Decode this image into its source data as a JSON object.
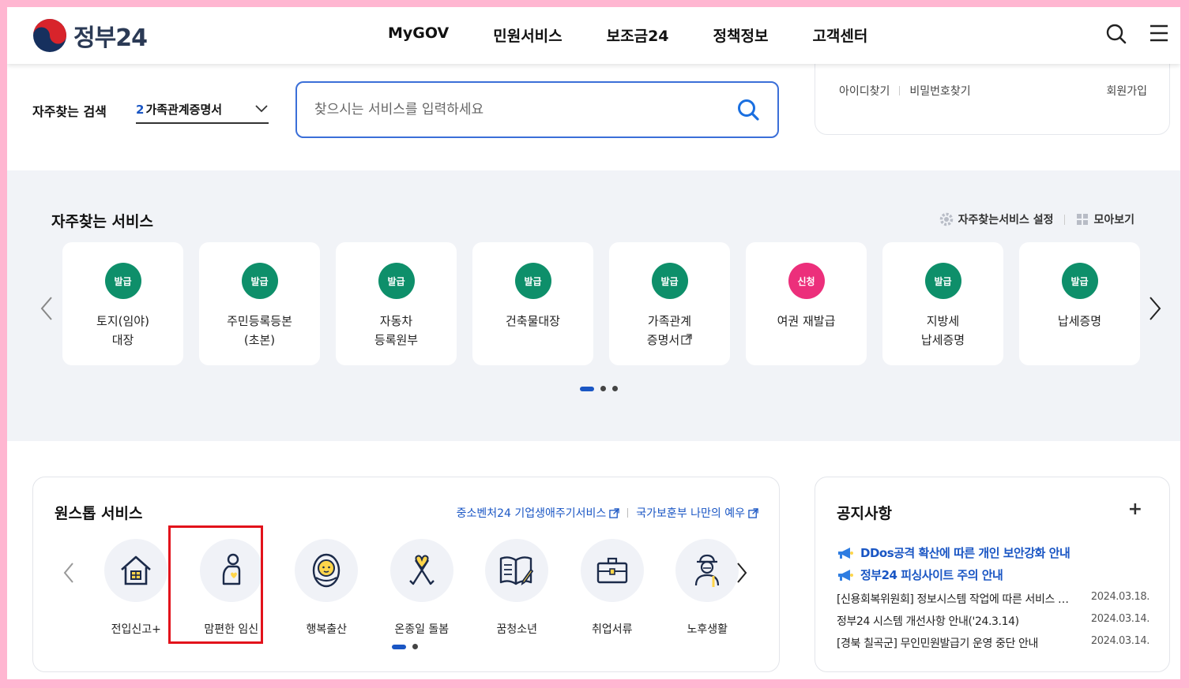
{
  "header": {
    "logo_text": "정부24",
    "nav": [
      "MyGOV",
      "민원서비스",
      "보조금24",
      "정책정보",
      "고객센터"
    ]
  },
  "search": {
    "freq_label": "자주찾는 검색",
    "freq_rank": "2",
    "freq_value": "가족관계증명서",
    "placeholder": "찾으시는 서비스를 입력하세요"
  },
  "login": {
    "find_id": "아이디찾기",
    "find_pw": "비밀번호찾기",
    "signup": "회원가입"
  },
  "frequent": {
    "title": "자주찾는 서비스",
    "settings_label": "자주찾는서비스 설정",
    "view_all_label": "모아보기",
    "items": [
      {
        "badge": "발급",
        "name": "토지(임야)\n대장",
        "color": "#0e8f6a"
      },
      {
        "badge": "발급",
        "name": "주민등록등본\n(초본)",
        "color": "#0e8f6a"
      },
      {
        "badge": "발급",
        "name": "자동차\n등록원부",
        "color": "#0e8f6a"
      },
      {
        "badge": "발급",
        "name": "건축물대장",
        "color": "#0e8f6a"
      },
      {
        "badge": "발급",
        "name": "가족관계\n증명서",
        "color": "#0e8f6a"
      },
      {
        "badge": "신청",
        "name": "여권 재발급",
        "color": "#ec2f7b"
      },
      {
        "badge": "발급",
        "name": "지방세\n납세증명",
        "color": "#0e8f6a"
      },
      {
        "badge": "발급",
        "name": "납세증명",
        "color": "#0e8f6a"
      }
    ]
  },
  "onestop": {
    "title": "원스톱 서비스",
    "link1": "중소벤처24 기업생애주기서비스",
    "link2": "국가보훈부 나만의 예우",
    "items": [
      {
        "label": "전입신고+",
        "icon": "house-icon"
      },
      {
        "label": "맘편한 임신",
        "icon": "pregnancy-icon"
      },
      {
        "label": "행복출산",
        "icon": "baby-icon"
      },
      {
        "label": "온종일 돌봄",
        "icon": "ribbon-heart-icon"
      },
      {
        "label": "꿈청소년",
        "icon": "book-pen-icon"
      },
      {
        "label": "취업서류",
        "icon": "briefcase-icon"
      },
      {
        "label": "노후생활",
        "icon": "elder-icon"
      }
    ]
  },
  "notice": {
    "title": "공지사항",
    "plus": "+",
    "highlights": [
      "DDos공격 확산에 따른 개인 보안강화 안내",
      "정부24 피싱사이트 주의 안내"
    ],
    "rows": [
      {
        "title": "[신용회복위원회] 정보시스템 작업에 따른 서비스 이용 중단 안내",
        "date": "2024.03.18."
      },
      {
        "title": "정부24 시스템 개선사항 안내('24.3.14)",
        "date": "2024.03.14."
      },
      {
        "title": "[경북 칠곡군] 무인민원발급기 운영 중단 안내",
        "date": "2024.03.14."
      }
    ]
  }
}
